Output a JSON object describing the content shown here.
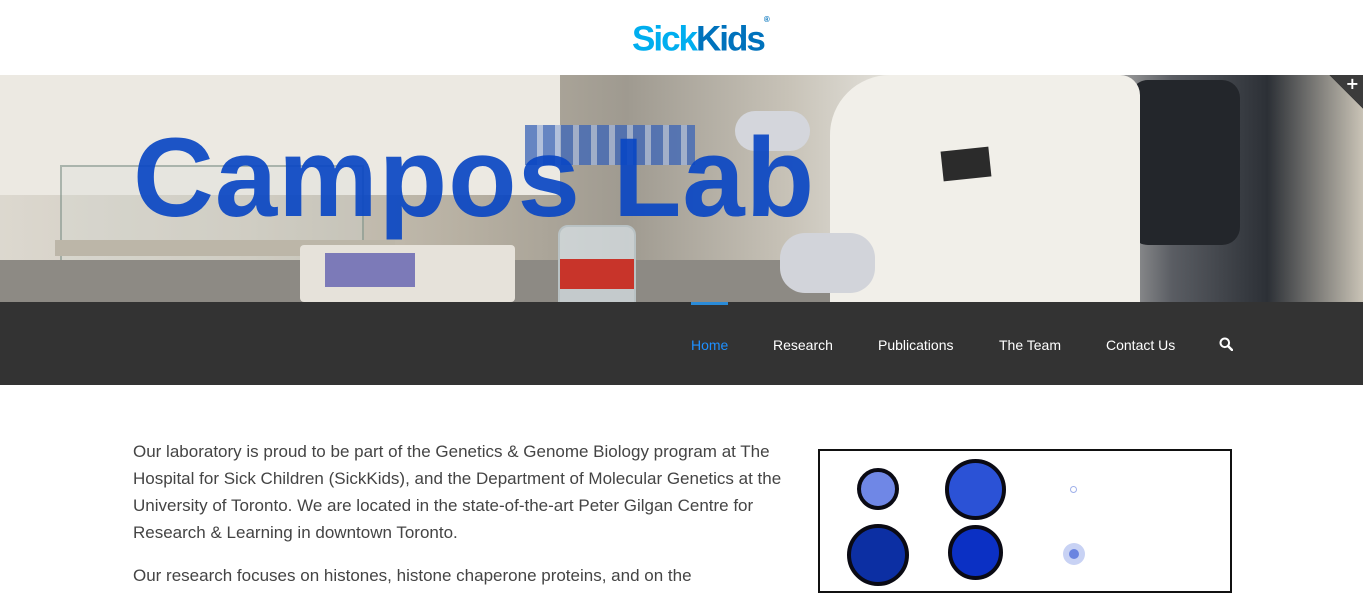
{
  "header": {
    "logo_sick": "Sick",
    "logo_kids": "Kids",
    "logo_mark": "®"
  },
  "hero": {
    "title": "Campos Lab",
    "toggle_label": "+"
  },
  "nav": {
    "items": [
      {
        "label": "Home",
        "active": true
      },
      {
        "label": "Research",
        "active": false
      },
      {
        "label": "Publications",
        "active": false
      },
      {
        "label": "The Team",
        "active": false
      },
      {
        "label": "Contact Us",
        "active": false
      }
    ],
    "search_icon": "search-icon"
  },
  "main": {
    "paragraphs": [
      "Our laboratory is proud to be part of the Genetics & Genome Biology program at The Hospital for Sick Children (SickKids), and the Department of Molecular Genetics at the University of Toronto. We are located in the state-of-the-art Peter Gilgan Centre for Research & Learning in downtown Toronto.",
      "Our research focuses on histones, histone chaperone proteins, and on the"
    ]
  },
  "colors": {
    "brand_light": "#00aeef",
    "brand_dark": "#0072bc",
    "hero_title": "#0a46c3",
    "nav_bg": "#333333",
    "nav_active": "#1e90ff",
    "body_text": "#444444"
  }
}
